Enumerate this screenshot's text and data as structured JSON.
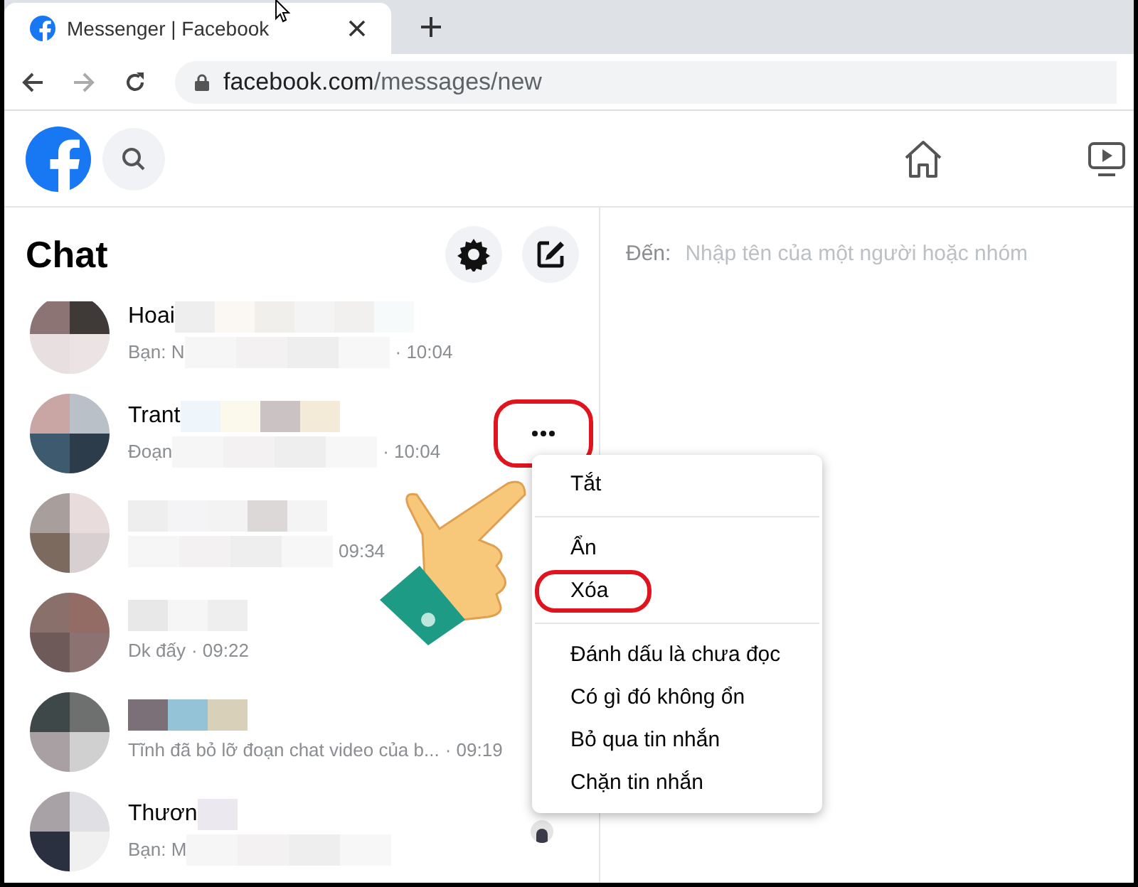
{
  "browser": {
    "tab": {
      "title": "Messenger | Facebook"
    },
    "address": {
      "domain": "facebook.com",
      "path": "/messages/new"
    }
  },
  "sidebar": {
    "title": "Chat"
  },
  "compose": {
    "label": "Đến:",
    "placeholder": "Nhập tên của một người hoặc nhóm"
  },
  "conversations": [
    {
      "name": "Hoai",
      "preview": "Bạn: N",
      "time": "· 10:04"
    },
    {
      "name": "Trant",
      "preview": "Đoạn",
      "time": "· 10:04",
      "more_button": {
        "highlighted": true
      }
    },
    {
      "time": "09:34"
    },
    {
      "preview": "Dk đấy",
      "time": "· 09:22"
    },
    {
      "preview": "Tĩnh đã bỏ lỡ đoạn chat video của b...",
      "time": "· 09:19"
    },
    {
      "name": "Thươn",
      "preview": "Bạn: M",
      "seen": true
    }
  ],
  "context_menu": {
    "groups": [
      {
        "items": [
          {
            "label": "Tắt",
            "highlighted": false
          }
        ]
      },
      {
        "items": [
          {
            "label": "Ẩn",
            "highlighted": false
          },
          {
            "label": "Xóa",
            "highlighted": true
          }
        ]
      },
      {
        "items": [
          {
            "label": "Đánh dấu là chưa đọc",
            "highlighted": false
          },
          {
            "label": "Có gì đó không ổn",
            "highlighted": false
          },
          {
            "label": "Bỏ qua tin nhắn",
            "highlighted": false
          },
          {
            "label": "Chặn tin nhắn",
            "highlighted": false
          }
        ]
      }
    ]
  }
}
